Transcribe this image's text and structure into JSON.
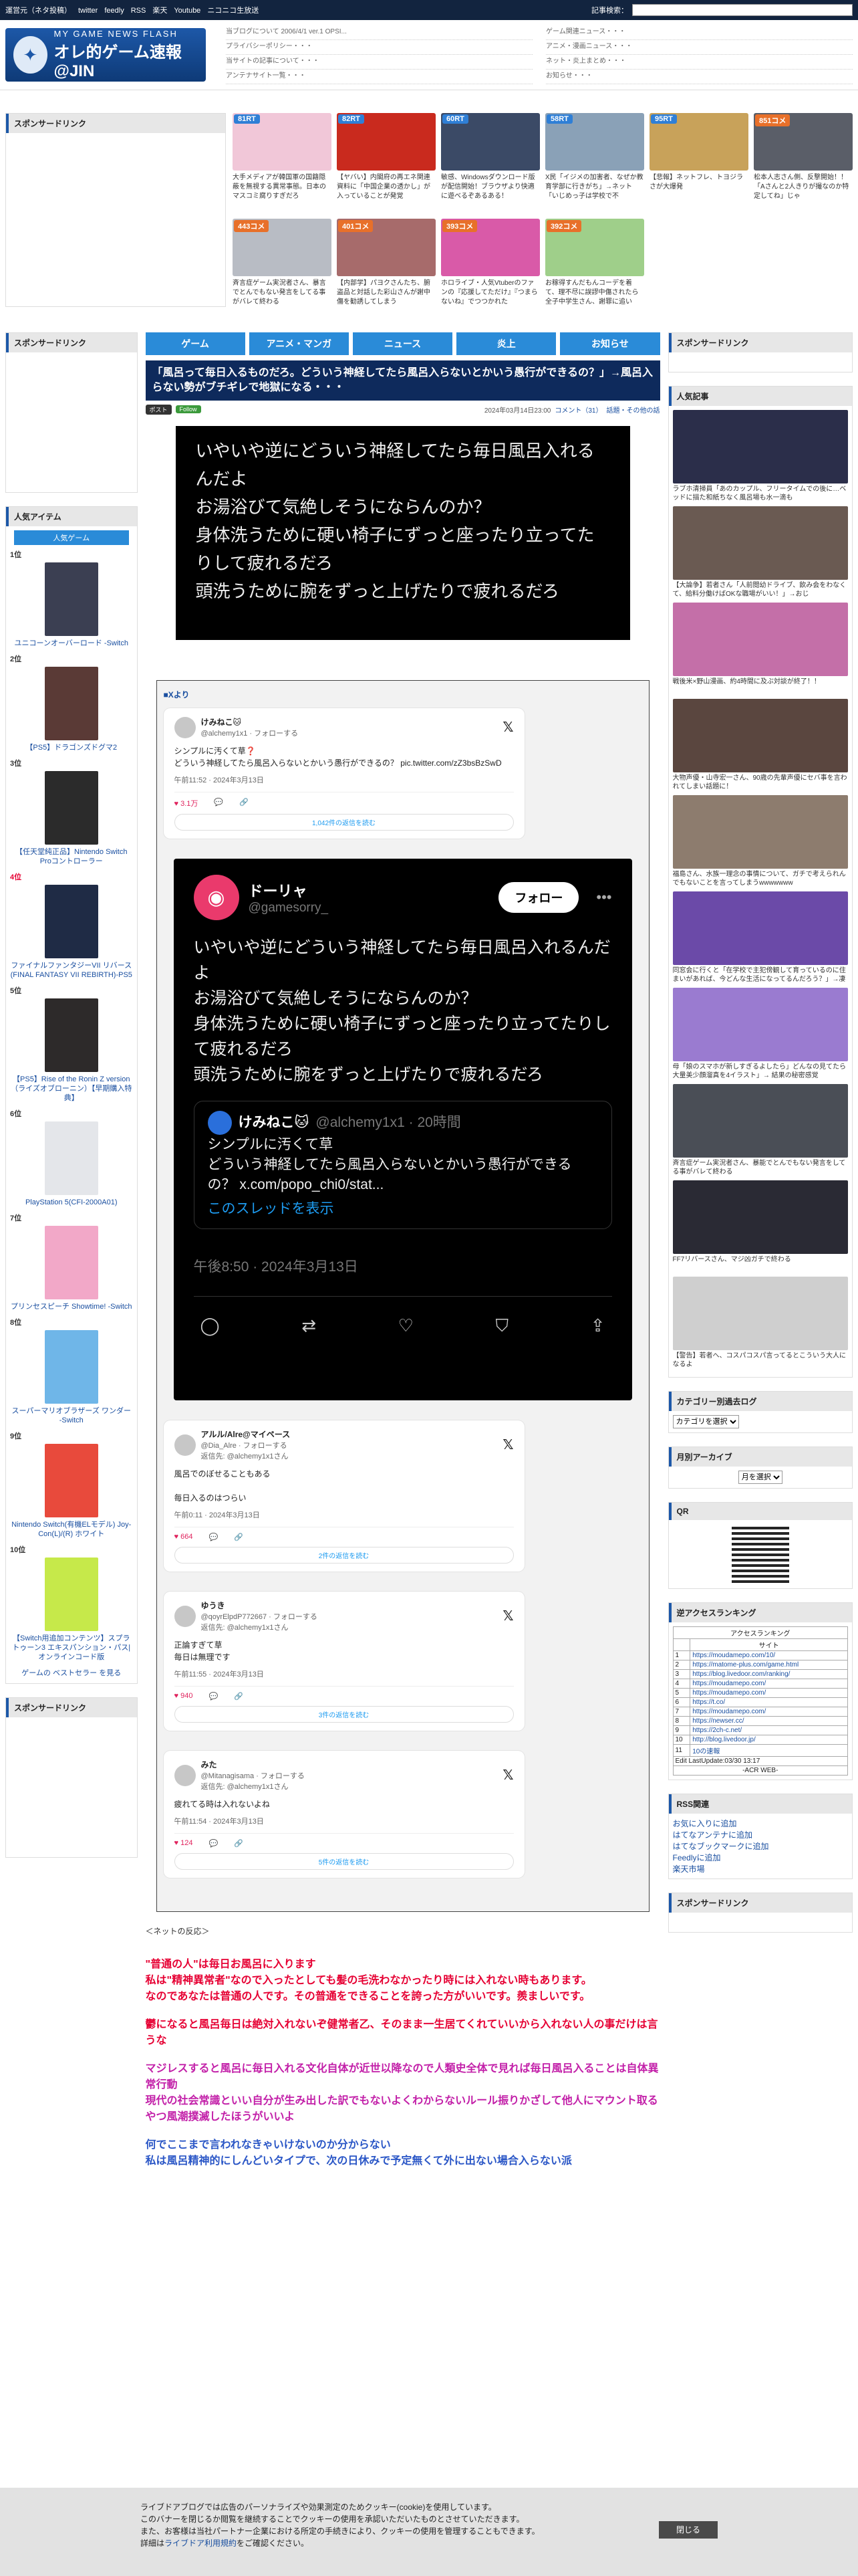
{
  "topbar": {
    "links": [
      "運営元（ネタ投稿）",
      "twitter",
      "feedly",
      "RSS",
      "楽天",
      "Youtube",
      "ニコニコ生放送"
    ],
    "search_label": "記事検索："
  },
  "header": {
    "logo_small": "MY GAME NEWS FLASH",
    "logo_big": "オレ的ゲーム速報@JIN",
    "news_col1": [
      "当ブログについて 2006/4/1 ver.1 OPSI...",
      "プライバシーポリシー・・・",
      "当サイトの記事について・・・",
      "アンテナサイト一覧・・・"
    ],
    "news_col2": [
      "ゲーム関連ニュース・・・",
      "アニメ・漫画ニュース・・・",
      "ネット・炎上まとめ・・・",
      "お知らせ・・・"
    ]
  },
  "sponsor_title": "スポンサードリンク",
  "grid": [
    {
      "badge": "81RT",
      "red": false,
      "cap": "大手メディアが韓国軍の国籍隠蔽を無視する異常事態。日本のマスコミ腐りすぎだろ",
      "color": "#f1c7d8"
    },
    {
      "badge": "82RT",
      "red": false,
      "cap": "【ヤバい】内閣府の再エネ関連資料に「中国企業の透かし」が入っていることが発覚",
      "color": "#c92a1e"
    },
    {
      "badge": "60RT",
      "red": false,
      "cap": "敏感、Windowsダウンロード版が配信開始！ブラウザより快適に遊べるぞあるある！",
      "color": "#3b4a66"
    },
    {
      "badge": "58RT",
      "red": false,
      "cap": "X民「イジメの加害者、なぜか教育学部に行きがち」→ネット「いじめっ子は学校で不",
      "color": "#8aa1b7"
    },
    {
      "badge": "95RT",
      "red": false,
      "cap": "【悲報】ネットフレ、トヨジラさが大爆発",
      "color": "#c8a25a"
    },
    {
      "badge": "851コメ",
      "red": true,
      "cap": "松本人志さん側、反撃開始！！「Aさんと2人きりが撮なのか特定してね」じゃ",
      "color": "#5a5e68"
    },
    {
      "badge": "443コメ",
      "red": true,
      "cap": "斉言症ゲーム実況者さん、暴言でとんでもない発言をしてる事がバレて終わる",
      "color": "#b8bcc4"
    },
    {
      "badge": "401コメ",
      "red": true,
      "cap": "【内部学】パヨクさんたち、腑盗品と対話した彩山さんが謝中傷を勧誘してしまう",
      "color": "#a76b6b"
    },
    {
      "badge": "393コメ",
      "red": true,
      "cap": "ホロライブ・人気Vtuberのファンの『応援してただけ』『つまらないね』でつつかれた",
      "color": "#d95aa8"
    },
    {
      "badge": "392コメ",
      "red": true,
      "cap": "お稼得すんだもんコーデを着て、理不尽に誤謬中傷されたら全子中学生さん、謝罪に追い",
      "color": "#9fcf8a"
    }
  ],
  "nav": [
    "ゲーム",
    "アニメ・マンガ",
    "ニュース",
    "炎上",
    "お知らせ"
  ],
  "left": {
    "popular_title": "人気アイテム",
    "popular_tab": "人気ゲーム",
    "items": [
      {
        "rank": "1位",
        "red": false,
        "name": "ユニコーンオーバーロード -Switch",
        "color": "#3b3f52"
      },
      {
        "rank": "2位",
        "red": false,
        "name": "【PS5】ドラゴンズドグマ2",
        "color": "#5a3a36"
      },
      {
        "rank": "3位",
        "red": false,
        "name": "【任天堂純正品】Nintendo Switch Proコントローラー",
        "color": "#2b2b2b"
      },
      {
        "rank": "4位",
        "red": true,
        "name": "ファイナルファンタジーVII リバース(FINAL FANTASY VII REBIRTH)-PS5",
        "color": "#1f2b45"
      },
      {
        "rank": "5位",
        "red": false,
        "name": "【PS5】Rise of the Ronin Z version（ライズオブローニン）【早期購入特典】",
        "color": "#2d2a2a"
      },
      {
        "rank": "6位",
        "red": false,
        "name": "PlayStation 5(CFI-2000A01)",
        "color": "#e4e6ea"
      },
      {
        "rank": "7位",
        "red": false,
        "name": "プリンセスピーチ Showtime! -Switch",
        "color": "#f2a8c8"
      },
      {
        "rank": "8位",
        "red": false,
        "name": "スーパーマリオブラザーズ ワンダー -Switch",
        "color": "#6fb6e8"
      },
      {
        "rank": "9位",
        "red": false,
        "name": "Nintendo Switch(有機ELモデル) Joy-Con(L)/(R) ホワイト",
        "color": "#e84a3c"
      },
      {
        "rank": "10位",
        "red": false,
        "name": "【Switch用追加コンテンツ】スプラトゥーン3 エキスパンション・パス|オンラインコード版",
        "color": "#c6e94a"
      }
    ],
    "more": "ゲームの ベストセラー を見る"
  },
  "article": {
    "title": "「風呂って毎日入るものだろ。どういう神経してたら風呂入らないとかいう愚行ができるの？」→風呂入らない勢がブチギレで地獄になる・・・",
    "chip_post": "ポスト",
    "chip_follow": "Follow",
    "date": "2024年03月14日23:00",
    "comment_link": "コメント（31）",
    "category": "話題・その他の話",
    "screenshot_text": "いやいや逆にどういう神経してたら毎日風呂入れるんだよ\nお湯浴びて気絶しそうにならんのか？\n身体洗うために硬い椅子にずっと座ったり立ってたりして疲れるだろ\n頭洗うために腕をずっと上げたりで疲れるだろ",
    "x_label": "■Xより"
  },
  "tweets": [
    {
      "name": "けみねこ🐱",
      "handle": "@alchemy1x1 · フォローする",
      "body": "シンプルに汚くて草❓\nどういう神経してたら風呂入らないとかいう愚行ができるの？ pic.twitter.com/zZ3bsBzSwD",
      "time": "午前11:52 · 2024年3月13日",
      "likes": "3.1万",
      "replies": "返信",
      "share": "リンクをコピー",
      "more": "1,042件の返信を読む"
    }
  ],
  "big_tweet": {
    "name": "ドーリャ",
    "handle": "@gamesorry_",
    "follow": "フォロー",
    "body": "いやいや逆にどういう神経してたら毎日風呂入れるんだよ\nお湯浴びて気絶しそうにならんのか？\n身体洗うために硬い椅子にずっと座ったり立ってたりして疲れるだろ\n頭洗うために腕をずっと上げたりで疲れるだろ",
    "quote_name": "けみねこ🐱",
    "quote_handle": "@alchemy1x1 · 20時間",
    "quote_body": "シンプルに汚くて草\nどういう神経してたら風呂入らないとかいう愚行ができるの？ x.com/popo_chi0/stat...",
    "quote_show": "このスレッドを表示",
    "time": "午後8:50 · 2024年3月13日"
  },
  "replies": [
    {
      "name": "アルル/Alre@マイペース",
      "handle": "@Dia_Alre · フォローする",
      "to": "返信先: @alchemy1x1さん",
      "body": "風呂でのぼせることもある\n\n毎日入るのはつらい",
      "time": "午前0:11 · 2024年3月13日",
      "likes": "664",
      "more": "2件の返信を読む"
    },
    {
      "name": "ゆうき",
      "handle": "@qoyrElpdP772667 · フォローする",
      "to": "返信先: @alchemy1x1さん",
      "body": "正論すぎて草\n毎日は無理です",
      "time": "午前11:55 · 2024年3月13日",
      "likes": "940",
      "more": "3件の返信を読む"
    },
    {
      "name": "みた",
      "handle": "@Mitanagisama · フォローする",
      "to": "返信先: @alchemy1x1さん",
      "body": "疲れてる時は入れないよね",
      "time": "午前11:54 · 2024年3月13日",
      "likes": "124",
      "more": "5件の返信を読む"
    }
  ],
  "after": {
    "net": "＜ネットの反応＞",
    "c1": "\"普通の人\"は毎日お風呂に入ります\n私は\"精神異常者\"なので入ったとしても髪の毛洗わなかったり時には入れない時もあります。\nなのであなたは普通の人です。その普通をできることを誇った方がいいです。羨ましいです。",
    "c2": "鬱になると風呂毎日は絶対入れないぞ健常者乙、そのまま一生居てくれていいから入れない人の事だけは言うな",
    "c3": "マジレスすると風呂に毎日入れる文化自体が近世以降なので人類史全体で見れば毎日風呂入ることは自体異常行動\n現代の社会常識といい自分が生み出した訳でもないよくわからないルール振りかざして他人にマウント取るやつ風潮撲滅したほうがいいよ",
    "c4": "何でここまで言われなきゃいけないのか分からない\n私は風呂精神的にしんどいタイプで、次の日休みで予定無くて外に出ない場合入らない派"
  },
  "right": {
    "sponsor": "スポンサードリンク",
    "popular": "人気記事",
    "articles": [
      {
        "cap": "ラブホ清掃員「あのカップル、フリータイムでの後に…ベッドに描た和紙ちなく風呂場も水一滴も",
        "color": "#2b2e4a"
      },
      {
        "cap": "【大論争】若者さん「人前閲幼ドライブ、飲み会をわなくて、給料分働けばOKな職場がいい！」→おじ",
        "color": "#6a5a52"
      },
      {
        "cap": "戦後米×野山漫画、約4時間に及ぶ対談が終了！！",
        "color": "#c46fa8"
      },
      {
        "cap": "大物声優・山寺宏一さん、90歳の先輩声優にセバ事を言われてしまい話題に！",
        "color": "#5a463f"
      },
      {
        "cap": "福島さん、水族一理念の事情について、ガチで考えられんでもないことを言ってしまうwwwwwww",
        "color": "#8d7c6e"
      },
      {
        "cap": "同窓会に行くと「在学校で主犯傍観して育っているのに住まいがあれば、今どんな生活になってるんだろう？」→凄い",
        "color": "#6b4aa8"
      },
      {
        "cap": "母「娘のスマホが新しすぎるよしたら」どんなの見てたら大量美少顔溜真を4イラスト」→ 結果の秘密感覚",
        "color": "#9a7bd0"
      },
      {
        "cap": "斉言症ゲーム実況者さん、暴能でとんでもない発言をしてる事がバレて終わる",
        "color": "#4a4e56"
      },
      {
        "cap": "FF7リバースさん、マジ凶ガチで終わる",
        "color": "#2a2a34"
      },
      {
        "cap": "【警告】若者へ、コスパコスパ言ってるとこういう大人になるよ",
        "color": "#cfcfcf"
      }
    ],
    "cat_title": "カテゴリー別過去ログ",
    "cat_select": "カテゴリを選択",
    "month_title": "月別アーカイブ",
    "month_select": "月を選択",
    "qr_title": "QR",
    "acc_title": "逆アクセスランキング",
    "acc_head": "アクセスランキング",
    "acc_site": "サイト",
    "acc_rows": [
      "https://moudamepo.com/10/",
      "https://matome-plus.com/game.html",
      "https://blog.livedoor.com/ranking/",
      "https://moudamepo.com/",
      "https://moudamepo.com/",
      "https://t.co/",
      "https://moudamepo.com/",
      "https://newser.cc/",
      "https://2ch-c.net/",
      "http://blog.livedoor.jp/",
      "10の速報"
    ],
    "acc_update": "Edit LastUpdate:03/30 13:17",
    "acc_foot": "-ACR WEB-",
    "rss_title": "RSS関連",
    "rss_links": [
      "お気に入りに追加",
      "はてなアンテナに追加",
      "はてなブックマークに追加",
      "Feedlyに追加",
      "楽天市場"
    ]
  },
  "cookie": {
    "text": "ライブドアブログでは広告のパーソナライズや効果測定のためクッキー(cookie)を使用しています。\nこのバナーを閉じるか閲覧を継続することでクッキーの使用を承認いただいたものとさせていただきます。\nまた、お客様は当社パートナー企業における所定の手続きにより、クッキーの使用を管理することもできます。",
    "policy_prefix": "詳細は",
    "policy_link": "ライブドア利用規約",
    "policy_suffix": "をご確認ください。",
    "close": "閉じる"
  }
}
